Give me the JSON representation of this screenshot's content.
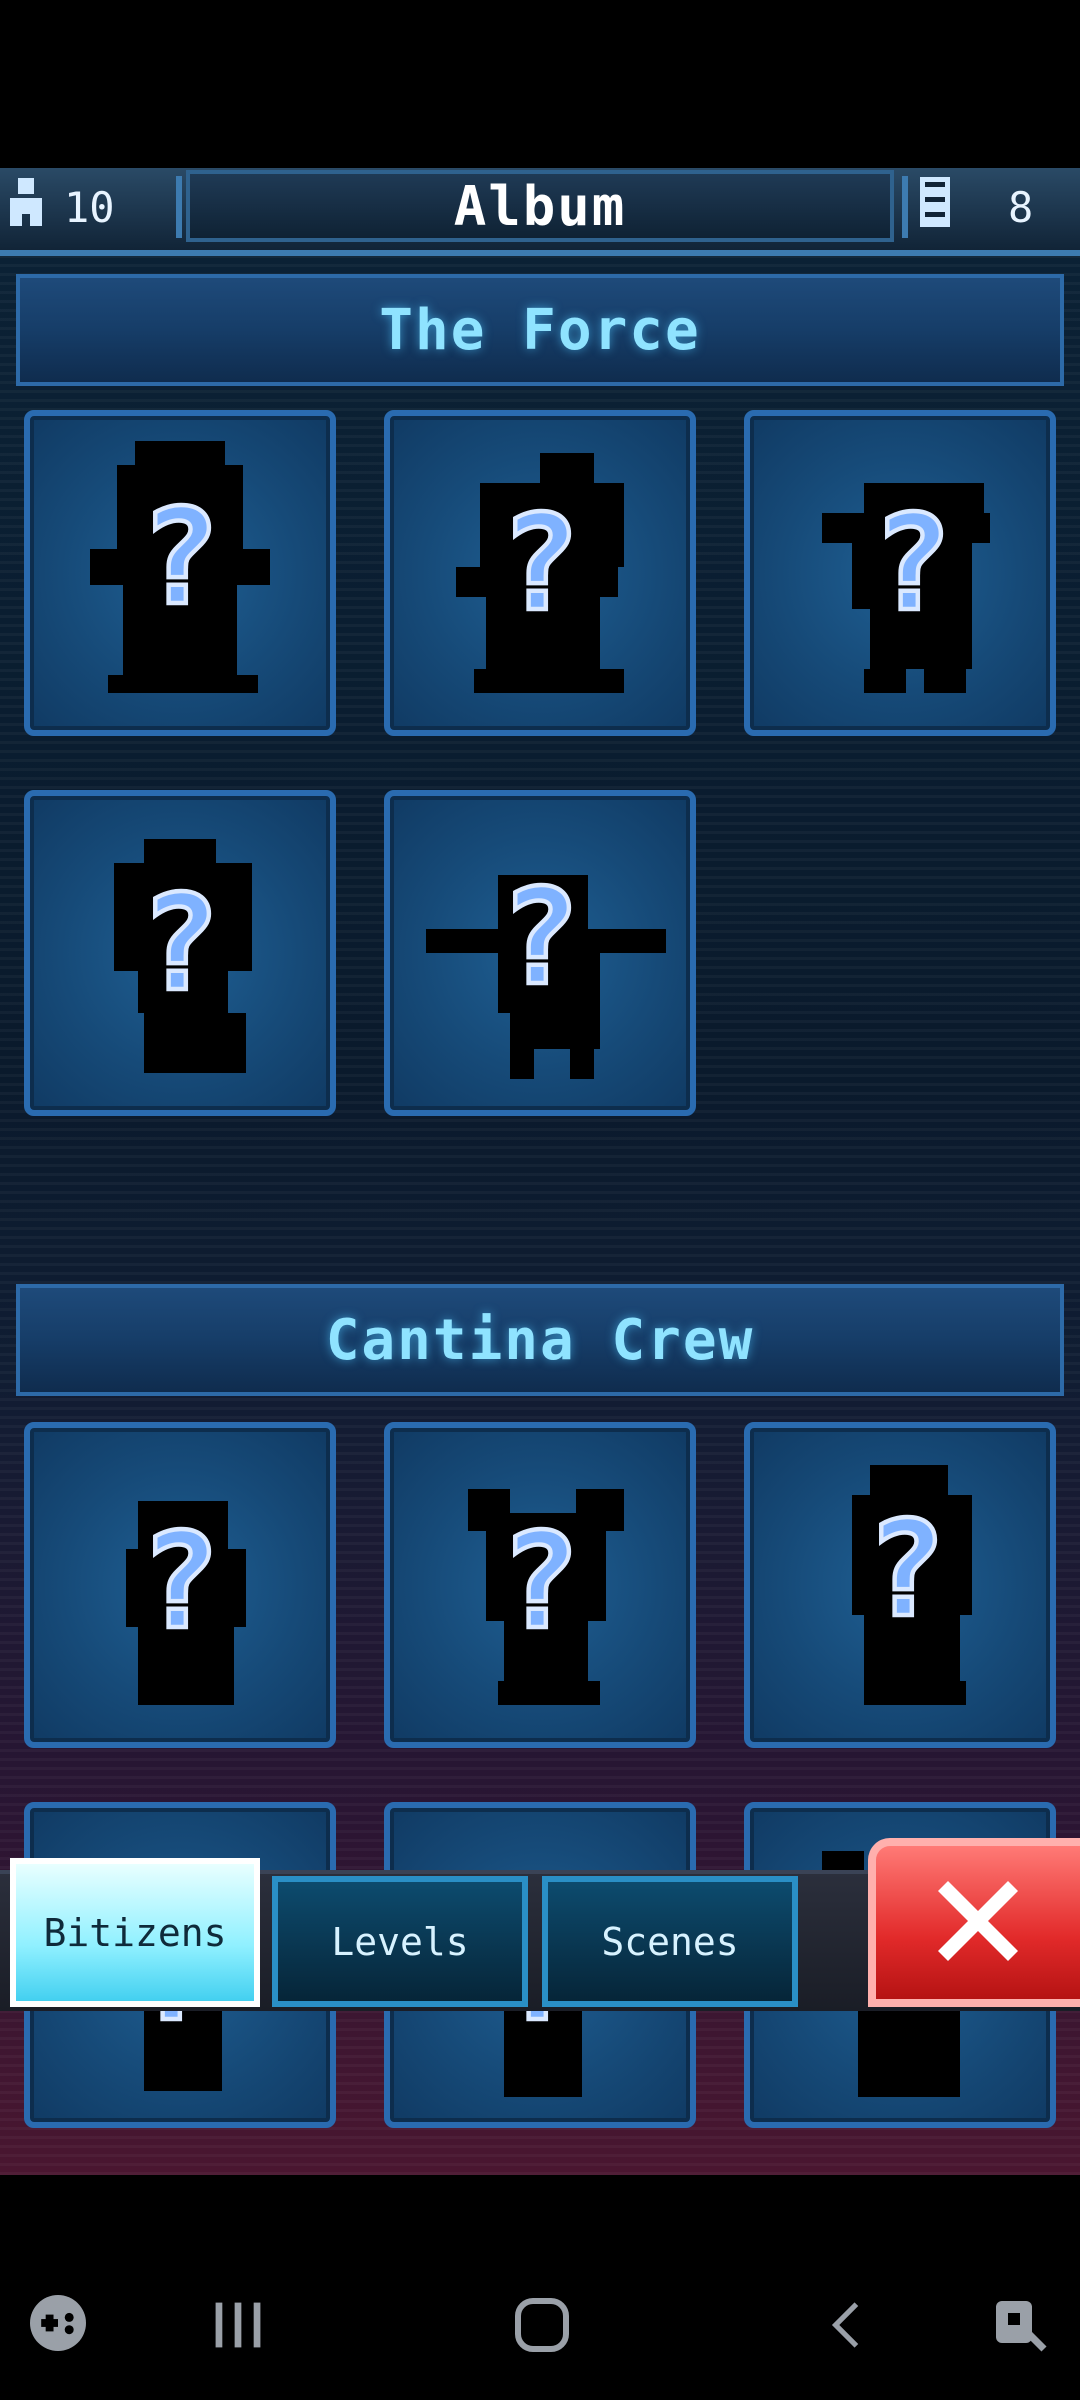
{
  "header": {
    "title": "Album",
    "population": "10",
    "floors": "8"
  },
  "sections": [
    {
      "title": "The Force"
    },
    {
      "title": "Cantina Crew"
    }
  ],
  "card_symbol": "?",
  "tabs": [
    {
      "label": "Bitizens",
      "active": true
    },
    {
      "label": "Levels",
      "active": false
    },
    {
      "label": "Scenes",
      "active": false
    }
  ],
  "icons": {
    "population": "person-icon",
    "floors": "building-icon",
    "close": "close-icon"
  },
  "colors": {
    "accent": "#2a6bb0",
    "header_text": "#8fe3ff",
    "close": "#e22a2a",
    "active_tab": "#8ff0ff"
  }
}
